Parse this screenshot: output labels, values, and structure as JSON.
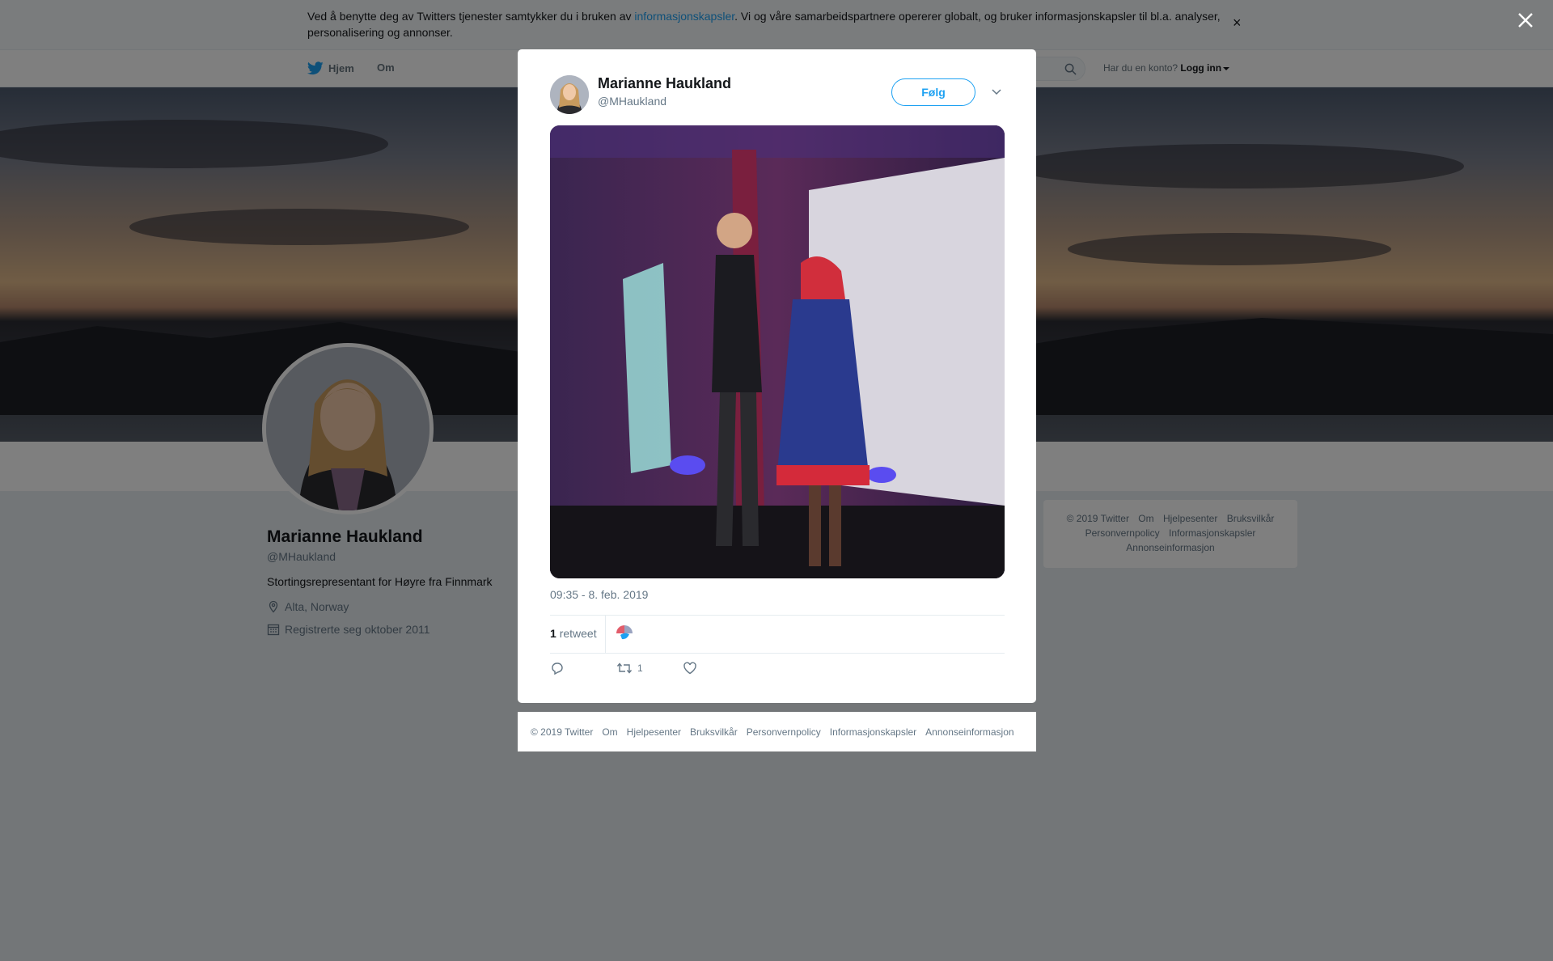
{
  "cookie_banner": {
    "text_before": "Ved å benytte deg av Twitters tjenester samtykker du i bruken av ",
    "link_text": "informasjonskapsler",
    "text_after": ". Vi og våre samarbeidspartnere opererer globalt, og bruker informasjonskapsler til bl.a. analyser, personalisering og annonser.",
    "close_glyph": "×"
  },
  "topnav": {
    "home_label": "Hjem",
    "about_label": "Om",
    "account_prompt": "Har du en konto?",
    "login_label": "Logg inn"
  },
  "profile": {
    "name": "Marianne Haukland",
    "handle": "@MHaukland",
    "bio": "Stortingsrepresentant for Høyre fra Finnmark",
    "location": "Alta, Norway",
    "joined": "Registrerte seg oktober 2011"
  },
  "side_footer": {
    "links": [
      "© 2019 Twitter",
      "Om",
      "Hjelpesenter",
      "Bruksvilkår",
      "Personvernpolicy",
      "Informasjonskapsler",
      "Annonseinformasjon"
    ]
  },
  "tweet": {
    "author_name": "Marianne Haukland",
    "author_handle": "@MHaukland",
    "follow_label": "Følg",
    "timestamp": "09:35 - 8. feb. 2019",
    "retweet_count": "1",
    "retweet_label": "retweet",
    "action_retweet_count": "1"
  },
  "modal_footer": {
    "links": [
      "© 2019 Twitter",
      "Om",
      "Hjelpesenter",
      "Bruksvilkår",
      "Personvernpolicy",
      "Informasjonskapsler",
      "Annonseinformasjon"
    ]
  },
  "colors": {
    "brand": "#1da1f2",
    "background": "#e6ecf0",
    "muted_text": "#657786"
  },
  "icons": {
    "nav_home": "twitter-bird-icon",
    "search": "search-icon",
    "location": "location-pin-icon",
    "calendar": "calendar-icon",
    "reply": "reply-icon",
    "retweet": "retweet-icon",
    "like": "heart-icon",
    "close": "close-icon",
    "more": "chevron-down-icon"
  }
}
